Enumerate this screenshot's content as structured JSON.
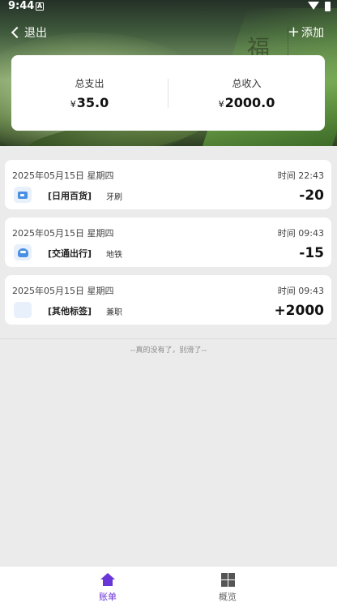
{
  "status_bar": {
    "time": "9:44",
    "notification_glyph": "A"
  },
  "header": {
    "back_label": "退出",
    "add_label": "添加",
    "plus_symbol": "+",
    "decor_glyph": "福"
  },
  "summary": {
    "expense_label": "总支出",
    "expense_currency": "¥",
    "expense_value": "35.0",
    "income_label": "总收入",
    "income_currency": "¥",
    "income_value": "2000.0"
  },
  "records": [
    {
      "date": "2025年05月15日 星期四",
      "time": "时间 22:43",
      "icon": "shopping-bag-icon",
      "category": "[日用百货]",
      "note": "牙刷",
      "amount": "-20"
    },
    {
      "date": "2025年05月15日 星期四",
      "time": "时间 09:43",
      "icon": "bus-icon",
      "category": "[交通出行]",
      "note": "地铁",
      "amount": "-15"
    },
    {
      "date": "2025年05月15日 星期四",
      "time": "时间 09:43",
      "icon": "grid-icon",
      "category": "[其他标签]",
      "note": "兼职",
      "amount": "+2000"
    }
  ],
  "end_tip": "--真的没有了，别滑了--",
  "tabbar": {
    "bill_label": "账单",
    "overview_label": "概览"
  },
  "colors": {
    "accent": "#6a35d6",
    "icon_blue": "#4a90e2",
    "background": "#ebebeb"
  }
}
